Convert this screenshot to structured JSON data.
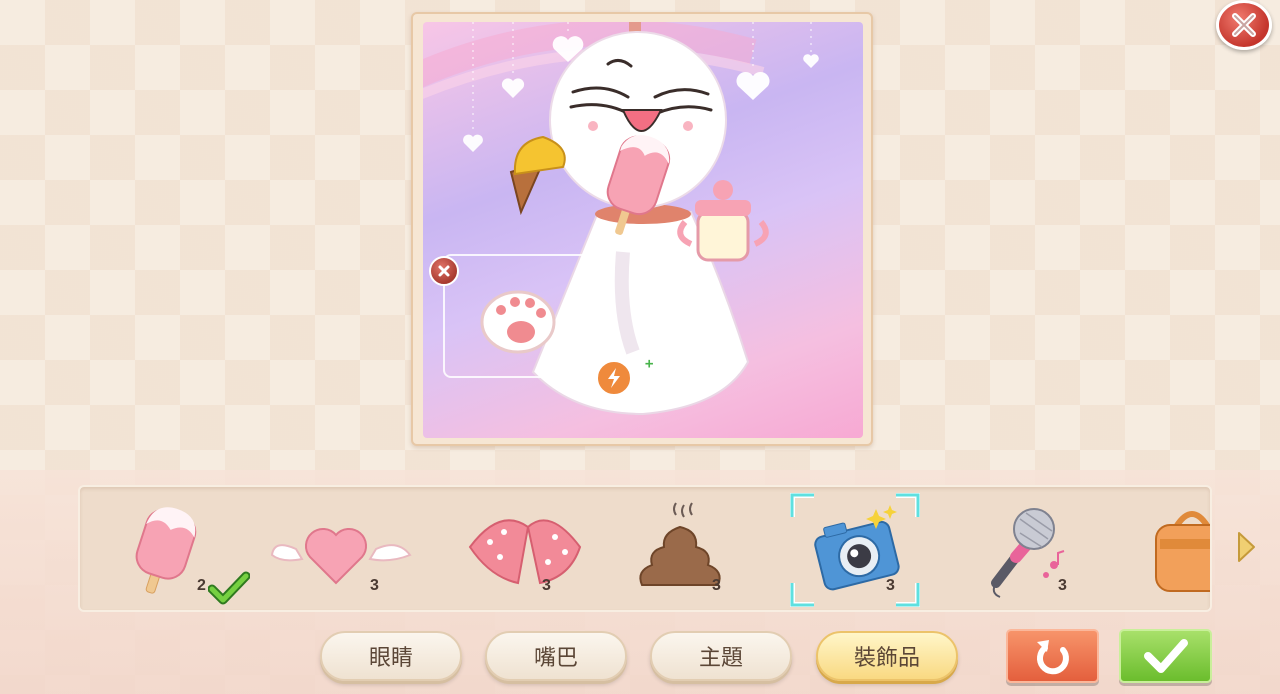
{
  "window": {
    "close_icon": "close-x-icon"
  },
  "preview": {
    "character": "white-ghost-doll",
    "accessories": [
      "ice-cream-cone",
      "popsicle",
      "baby-bottle",
      "cat-paw"
    ],
    "selected_accessory": "cat-paw"
  },
  "inventory": {
    "items": [
      {
        "icon": "popsicle-icon",
        "count": "2",
        "equipped": true
      },
      {
        "icon": "winged-heart-icon",
        "count": "3",
        "equipped": false
      },
      {
        "icon": "polka-dot-bow-icon",
        "count": "3",
        "equipped": false
      },
      {
        "icon": "poop-icon",
        "count": "3",
        "equipped": false
      },
      {
        "icon": "camera-icon",
        "count": "3",
        "equipped": false,
        "focused": true
      },
      {
        "icon": "microphone-icon",
        "count": "3",
        "equipped": false
      },
      {
        "icon": "handbag-icon",
        "count": "",
        "equipped": false
      }
    ],
    "next_icon": "chevron-right-icon"
  },
  "tabs": [
    {
      "label": "眼睛",
      "active": false
    },
    {
      "label": "嘴巴",
      "active": false
    },
    {
      "label": "主題",
      "active": false
    },
    {
      "label": "裝飾品",
      "active": true
    }
  ],
  "actions": {
    "reset_icon": "undo-arrow-icon",
    "confirm_icon": "checkmark-icon"
  },
  "colors": {
    "accent": "#f9d982",
    "confirm": "#6bbd2d",
    "reset": "#e45f3d",
    "close": "#c4352c"
  }
}
